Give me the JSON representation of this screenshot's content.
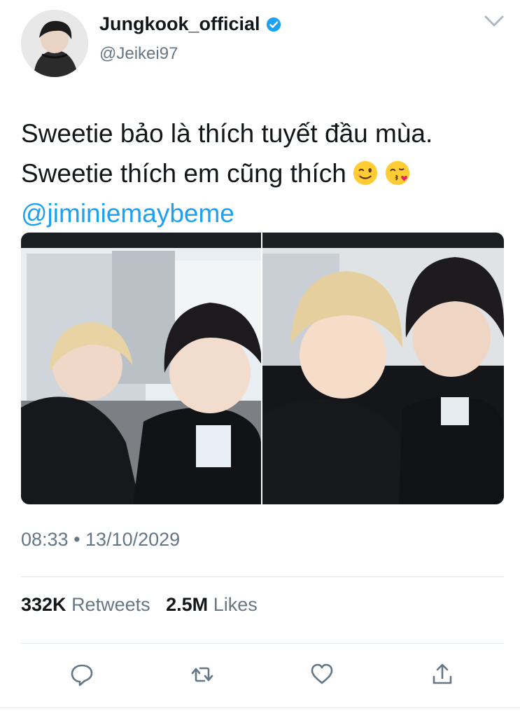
{
  "author": {
    "display_name": "Jungkook_official",
    "handle": "@Jeikei97",
    "verified": true
  },
  "tweet": {
    "line1": "Sweetie bảo là thích tuyết đầu mùa.",
    "line2": "Sweetie thích em cũng thích",
    "emojis": [
      "winking-face",
      "face-blowing-a-kiss"
    ],
    "mention": "@jiminiemaybeme",
    "timestamp": "08:33 • 13/10/2029"
  },
  "stats": {
    "retweets_count": "332K",
    "retweets_label": "Retweets",
    "likes_count": "2.5M",
    "likes_label": "Likes"
  },
  "actions": [
    "reply-icon",
    "retweet-icon",
    "like-icon",
    "share-icon"
  ],
  "colors": {
    "link": "#1da1f2",
    "secondary_text": "#657786",
    "primary_text": "#14171a",
    "divider": "#e1e8ed"
  }
}
